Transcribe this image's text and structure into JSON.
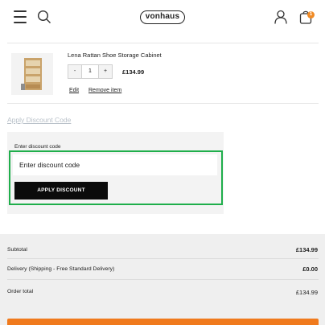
{
  "header": {
    "logo_text": "vonhaus",
    "bag_count": "1",
    "accent_color": "#f08a24"
  },
  "cart_item": {
    "name": "Lena Rattan Shoe Storage Cabinet",
    "quantity": "1",
    "minus_label": "-",
    "plus_label": "+",
    "price": "£134.99",
    "edit_label": "Edit",
    "remove_label": "Remove item"
  },
  "discount": {
    "toggle_label": "Apply Discount Code",
    "field_label": "Enter discount code",
    "input_placeholder": "Enter discount code",
    "input_value": "",
    "button_label": "APPLY DISCOUNT",
    "highlight_color": "#1fae4b"
  },
  "totals": {
    "subtotal_label": "Subtotal",
    "subtotal_value": "£134.99",
    "delivery_label": "Delivery (Shipping - Free Standard Delivery)",
    "delivery_value": "£0.00",
    "order_total_label": "Order total",
    "order_total_value": "£134.99"
  },
  "icons": {
    "menu": "hamburger-menu-icon",
    "search": "search-icon",
    "account": "user-icon",
    "bag": "shopping-bag-icon"
  },
  "colors": {
    "checkout_button": "#f07a1d",
    "apply_button": "#0b0b0b"
  }
}
